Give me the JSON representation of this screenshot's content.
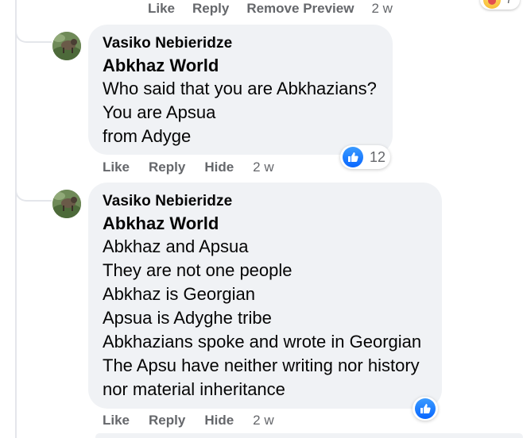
{
  "previous_comment": {
    "actions": [
      "Like",
      "Reply",
      "Remove Preview"
    ],
    "time": "2 w",
    "reaction_count": "7"
  },
  "comments": [
    {
      "author": "Vasiko Nebieridze",
      "tag": "Abkhaz World",
      "lines": [
        "Who said that you are Abkhazians?",
        "You are Apsua",
        "from Adyge"
      ],
      "actions": [
        "Like",
        "Reply",
        "Hide"
      ],
      "time": "2 w",
      "reaction_count": "12"
    },
    {
      "author": "Vasiko Nebieridze",
      "tag": "Abkhaz World",
      "lines": [
        "Abkhaz and Apsua",
        "They are not one people",
        "Abkhaz is Georgian",
        "Apsua is Adyghe tribe",
        "Abkhazians spoke and wrote in Georgian",
        "The Apsu have neither writing nor history",
        "nor material inheritance"
      ],
      "actions": [
        "Like",
        "Reply",
        "Hide"
      ],
      "time": "2 w",
      "reaction_count": ""
    }
  ],
  "icons": {
    "like": "like-thumb-icon",
    "haha": "haha-emoji-icon"
  },
  "colors": {
    "bubble": "#f0f2f5",
    "meta_text": "#65676b",
    "like_blue": "#0866ff"
  }
}
